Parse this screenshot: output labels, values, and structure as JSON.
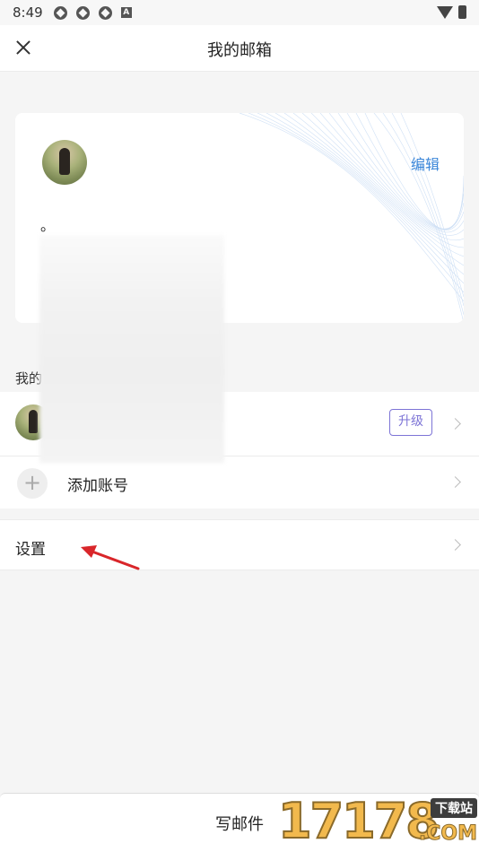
{
  "status_bar": {
    "time": "8:49",
    "icons": [
      "app-icon",
      "app-icon",
      "app-icon",
      "a-icon",
      "wifi-icon",
      "battery-icon"
    ]
  },
  "header": {
    "title": "我的邮箱",
    "close_icon": "close-icon"
  },
  "profile": {
    "edit_label": "编辑",
    "mark": "。"
  },
  "accounts": {
    "section_label": "我的",
    "upgrade_label": "升级",
    "add_account_label": "添加账号"
  },
  "settings": {
    "label": "设置"
  },
  "compose": {
    "label": "写邮件"
  },
  "watermark": {
    "brand": "17178",
    "tag": "下载站",
    "suffix": ".COM"
  },
  "colors": {
    "accent_blue": "#3a86d9",
    "upgrade_purple": "#7d74d6",
    "annotation_red": "#d9262a"
  }
}
